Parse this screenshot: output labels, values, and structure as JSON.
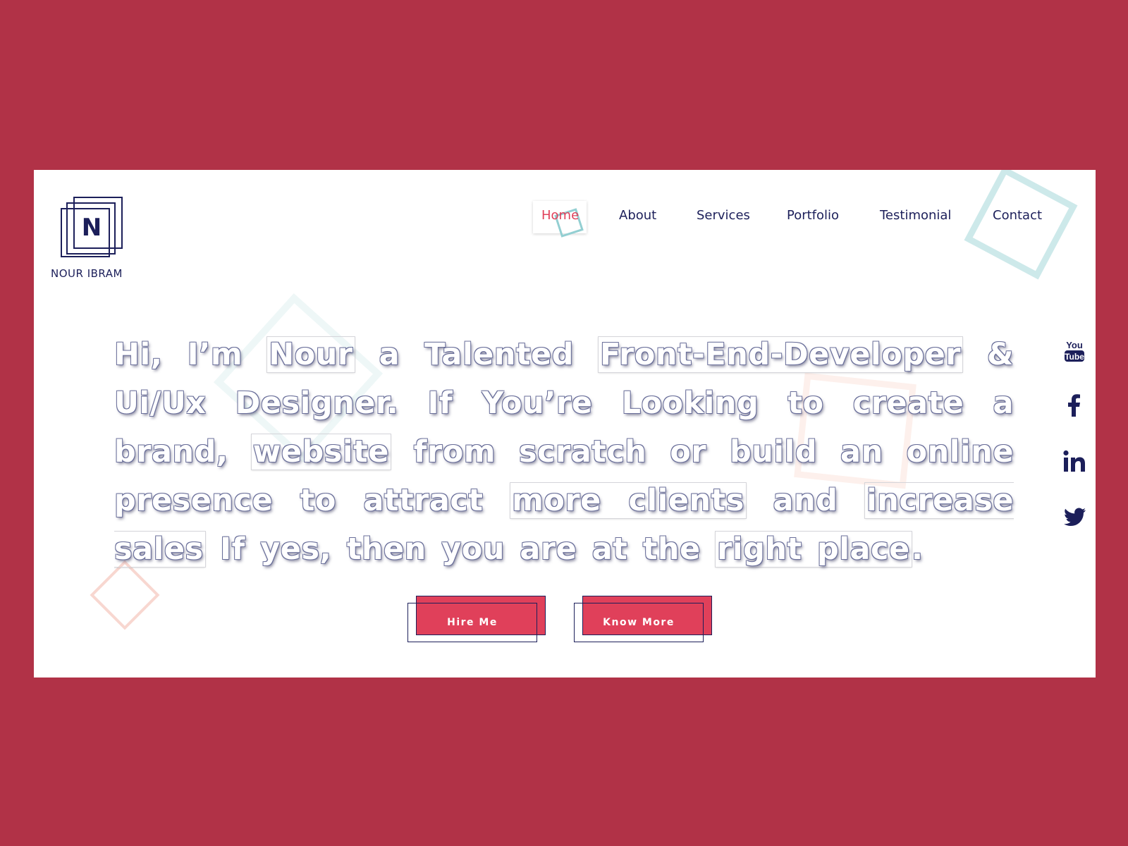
{
  "brand": {
    "letter": "N",
    "name": "NOUR IBRAM"
  },
  "nav": {
    "items": [
      {
        "label": "Home",
        "active": true
      },
      {
        "label": "About"
      },
      {
        "label": "Services"
      },
      {
        "label": "Portfolio"
      },
      {
        "label": "Testimonial"
      },
      {
        "label": "Contact"
      }
    ]
  },
  "hero": {
    "t1": "Hi, I’m ",
    "h1": "Nour",
    "t2": " a Talented ",
    "h2": "Front-End-Developer",
    "t3": " & Ui/Ux Designer. If You’re Looking to create a brand, ",
    "h3": "website",
    "t4": " from scratch or build an online presence to attract ",
    "h4": "more clients",
    "t5": " and ",
    "h5": "increase sales",
    "t6": " If yes, then you are at the ",
    "h6": "right place",
    "t7": "."
  },
  "buttons": {
    "hire": "Hire Me",
    "know": "Know More"
  },
  "social": {
    "youtube": {
      "top": "You",
      "bottom": "Tube"
    },
    "icons": [
      "youtube-icon",
      "facebook-icon",
      "linkedin-icon",
      "twitter-icon"
    ]
  },
  "colors": {
    "background": "#b13247",
    "accent": "#e0405a",
    "navy": "#1c1f5a",
    "teal_deco": "#cde9ea",
    "peach_deco": "#f8d7d0"
  }
}
